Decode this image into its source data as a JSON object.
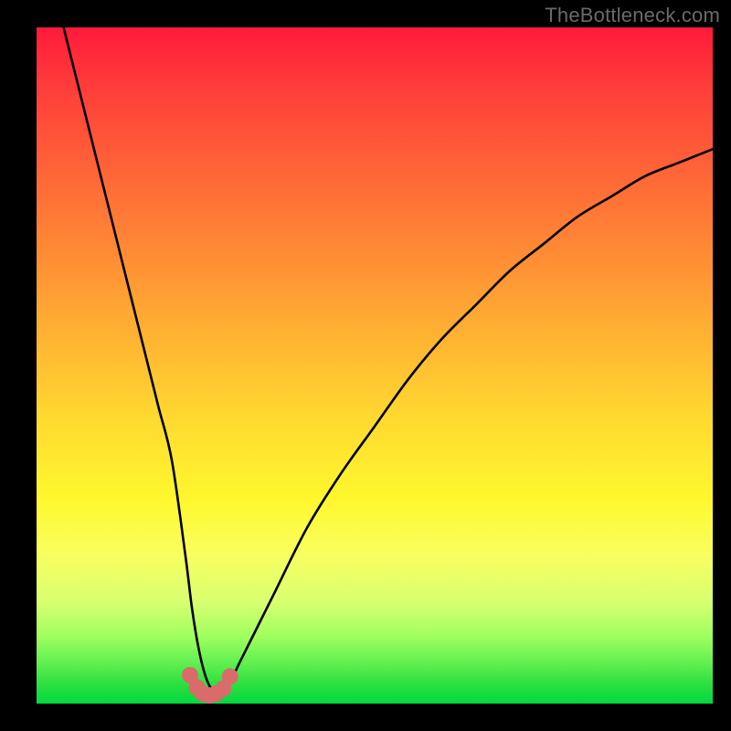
{
  "watermark": "TheBottleneck.com",
  "chart_data": {
    "type": "line",
    "title": "",
    "xlabel": "",
    "ylabel": "",
    "x_range": [
      0,
      100
    ],
    "y_range": [
      0,
      100
    ],
    "series": [
      {
        "name": "bottleneck-curve",
        "x": [
          4,
          6,
          8,
          10,
          12,
          14,
          16,
          18,
          20,
          22,
          23,
          24,
          25,
          26,
          27,
          28,
          29,
          30,
          32,
          35,
          40,
          45,
          50,
          55,
          60,
          65,
          70,
          75,
          80,
          85,
          90,
          95,
          100
        ],
        "y": [
          100,
          92,
          84,
          76,
          68,
          60,
          52,
          44,
          36,
          22,
          14,
          8,
          4,
          2,
          2,
          3,
          4,
          6,
          10,
          16,
          26,
          34,
          41,
          48,
          54,
          59,
          64,
          68,
          72,
          75,
          78,
          80,
          82
        ]
      }
    ],
    "markers": {
      "name": "optimal-range-dots",
      "color": "#d96b6b",
      "radius": 9,
      "x": [
        22.7,
        23.7,
        24.6,
        25.6,
        26.6,
        27.6,
        28.6
      ],
      "y": [
        4.2,
        2.4,
        1.5,
        1.2,
        1.5,
        2.2,
        4.0
      ]
    }
  }
}
